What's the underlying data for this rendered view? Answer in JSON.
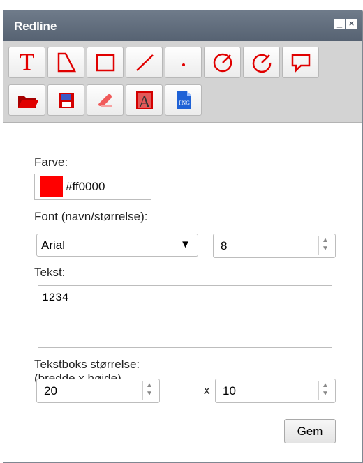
{
  "window": {
    "title": "Redline",
    "window_buttons": [
      "minimize",
      "close"
    ]
  },
  "toolbar": {
    "row1": [
      {
        "name": "text-tool",
        "glyph": "T"
      },
      {
        "name": "polygon-tool"
      },
      {
        "name": "rectangle-tool"
      },
      {
        "name": "line-tool"
      },
      {
        "name": "point-tool"
      },
      {
        "name": "circle-tool"
      },
      {
        "name": "arc-tool"
      },
      {
        "name": "speech-bubble-tool"
      }
    ],
    "row2": [
      {
        "name": "open-folder-tool"
      },
      {
        "name": "save-tool"
      },
      {
        "name": "eraser-tool"
      },
      {
        "name": "text-style-tool",
        "glyph": "A"
      },
      {
        "name": "png-export-tool",
        "glyph": "PNG"
      }
    ]
  },
  "form": {
    "color_label": "Farve:",
    "color_value": "#ff0000",
    "font_label": "Font (navn/størrelse):",
    "font_name": "Arial",
    "font_size": "8",
    "text_label": "Tekst:",
    "text_value": "1234",
    "box_size_label": "Tekstboks størrelse: (bredde x højde)",
    "box_width": "20",
    "box_x": "x",
    "box_height": "10",
    "save_button": "Gem"
  }
}
